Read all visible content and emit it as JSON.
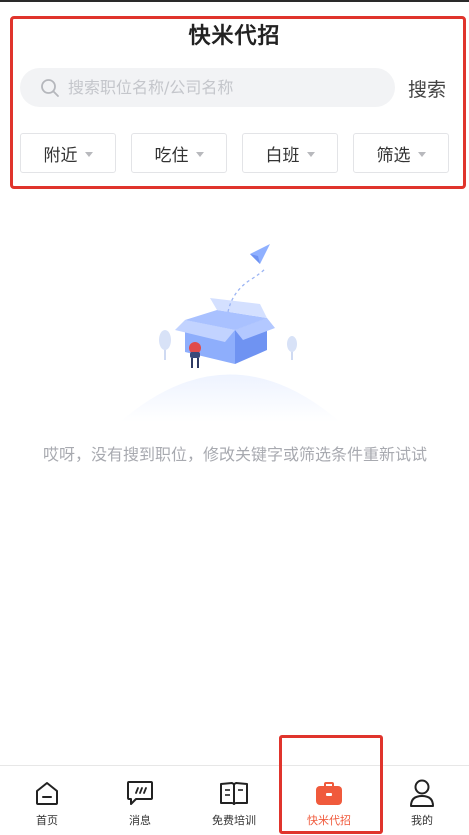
{
  "header": {
    "title": "快米代招"
  },
  "search": {
    "placeholder": "搜索职位名称/公司名称",
    "value": "",
    "button_label": "搜索"
  },
  "filters": [
    {
      "label": "附近"
    },
    {
      "label": "吃住"
    },
    {
      "label": "白班"
    },
    {
      "label": "筛选"
    }
  ],
  "empty_state": {
    "message": "哎呀，没有搜到职位，修改关键字或筛选条件重新试试"
  },
  "tabbar": {
    "items": [
      {
        "label": "首页",
        "icon": "home-icon"
      },
      {
        "label": "消息",
        "icon": "message-icon"
      },
      {
        "label": "免费培训",
        "icon": "book-icon"
      },
      {
        "label": "快米代招",
        "icon": "briefcase-icon",
        "active": true
      },
      {
        "label": "我的",
        "icon": "profile-icon"
      }
    ]
  },
  "colors": {
    "accent": "#f05a3c",
    "highlight_box": "#e0342c",
    "placeholder": "#c4c6cb",
    "empty_text": "#a8aab0"
  }
}
